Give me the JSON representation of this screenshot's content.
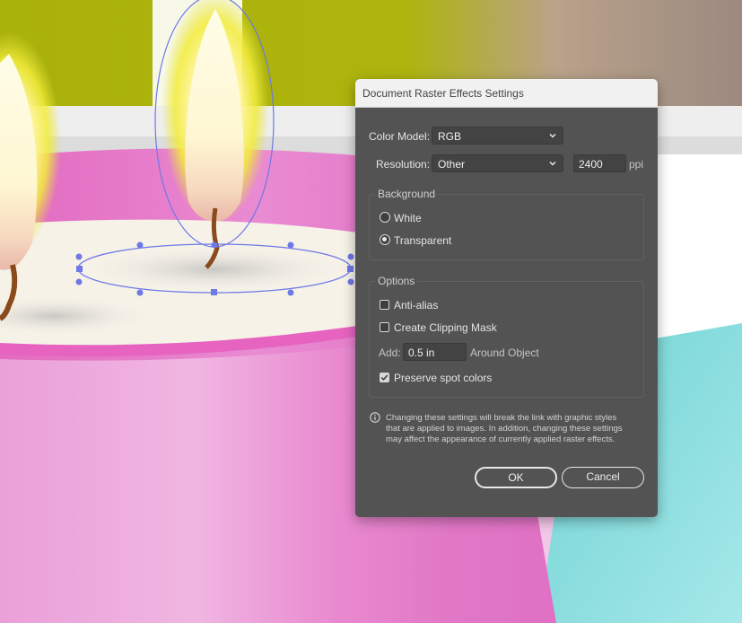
{
  "dialog": {
    "title": "Document Raster Effects Settings",
    "color_model": {
      "label": "Color Model:",
      "value": "RGB"
    },
    "resolution": {
      "label": "Resolution:",
      "value": "Other",
      "ppi_value": "2400",
      "unit": "ppi"
    },
    "background": {
      "title": "Background",
      "options": [
        {
          "label": "White",
          "selected": false
        },
        {
          "label": "Transparent",
          "selected": true
        }
      ]
    },
    "options": {
      "title": "Options",
      "anti_alias": {
        "label": "Anti-alias",
        "checked": false
      },
      "clipping_mask": {
        "label": "Create Clipping Mask",
        "checked": false
      },
      "add": {
        "label": "Add:",
        "value": "0.5 in",
        "suffix": "Around Object"
      },
      "preserve_spot": {
        "label": "Preserve spot colors",
        "checked": true
      }
    },
    "note_lines": [
      "Changing these settings will break the link with graphic styles",
      "that are applied to images. In addition, changing these settings",
      "may affect the appearance of currently applied raster effects."
    ],
    "ok_label": "OK",
    "cancel_label": "Cancel"
  },
  "colors": {
    "dialog_bg": "#535353",
    "title_bg": "#f1f1f1",
    "selection_blue": "#6e78e6",
    "pink": "#e56ac4",
    "olive": "#a8b20c",
    "teal": "#7fd8d8"
  },
  "icons": [
    "chevron-down-icon",
    "info-icon",
    "checkmark-icon"
  ]
}
